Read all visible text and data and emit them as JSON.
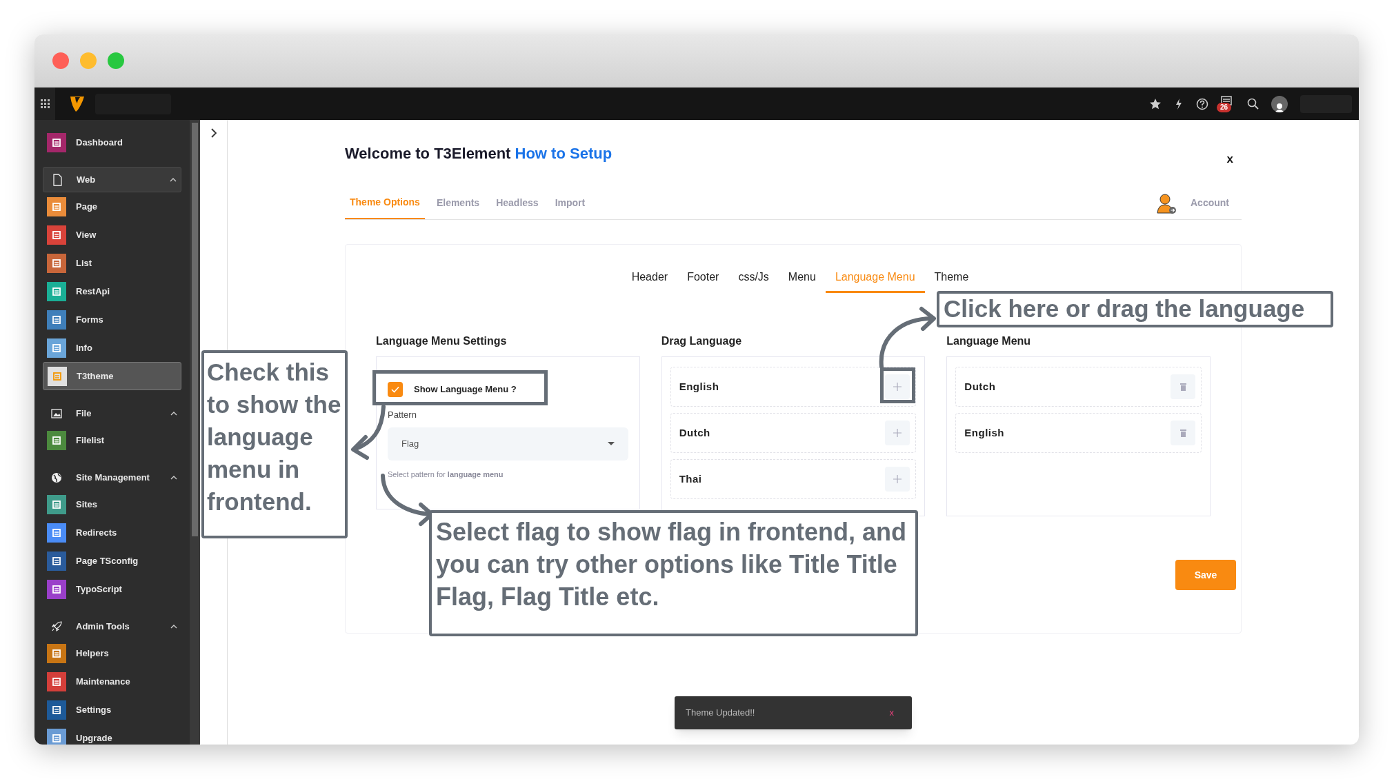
{
  "topbar": {
    "notification_count": "26"
  },
  "sidebar": [
    {
      "kind": "module",
      "label": "Dashboard",
      "color": "#a4276a",
      "selected": false
    },
    {
      "kind": "group",
      "label": "Web",
      "expanded": true,
      "selected": true,
      "children": [
        {
          "kind": "module",
          "label": "Page",
          "color": "#ea8c3a",
          "selected": false
        },
        {
          "kind": "module",
          "label": "View",
          "color": "#d9433a",
          "selected": false
        },
        {
          "kind": "module",
          "label": "List",
          "color": "#c8663a",
          "selected": false
        },
        {
          "kind": "module",
          "label": "RestApi",
          "color": "#1aaf96",
          "selected": false
        },
        {
          "kind": "module",
          "label": "Forms",
          "color": "#3f7fba",
          "selected": false
        },
        {
          "kind": "module",
          "label": "Info",
          "color": "#6aa5d9",
          "selected": false
        },
        {
          "kind": "module",
          "label": "T3theme",
          "color": "#e0e0e0",
          "selected": true
        }
      ]
    },
    {
      "kind": "group",
      "label": "File",
      "expanded": true,
      "selected": false,
      "children": [
        {
          "kind": "module",
          "label": "Filelist",
          "color": "#4c8a3e",
          "selected": false
        }
      ]
    },
    {
      "kind": "group",
      "label": "Site Management",
      "expanded": true,
      "selected": false,
      "children": [
        {
          "kind": "module",
          "label": "Sites",
          "color": "#3f9b8a",
          "selected": false
        },
        {
          "kind": "module",
          "label": "Redirects",
          "color": "#4a8cf6",
          "selected": false
        },
        {
          "kind": "module",
          "label": "Page TSconfig",
          "color": "#2a5b9b",
          "selected": false
        },
        {
          "kind": "module",
          "label": "TypoScript",
          "color": "#9a3fc9",
          "selected": false
        }
      ]
    },
    {
      "kind": "group",
      "label": "Admin Tools",
      "expanded": true,
      "selected": false,
      "children": [
        {
          "kind": "module",
          "label": "Helpers",
          "color": "#c87514",
          "selected": false
        },
        {
          "kind": "module",
          "label": "Maintenance",
          "color": "#d43f3a",
          "selected": false
        },
        {
          "kind": "module",
          "label": "Settings",
          "color": "#1d5a99",
          "selected": false
        },
        {
          "kind": "module",
          "label": "Upgrade",
          "color": "#6a9bd4",
          "selected": false
        }
      ]
    }
  ],
  "main": {
    "title": "Welcome to T3Element",
    "title_link": "How to Setup",
    "close": "x",
    "tabs": [
      {
        "label": "Theme Options",
        "selected": true
      },
      {
        "label": "Elements",
        "selected": false
      },
      {
        "label": "Headless",
        "selected": false
      },
      {
        "label": "Import",
        "selected": false
      }
    ],
    "account": "Account",
    "subtabs": [
      {
        "label": "Header",
        "selected": false
      },
      {
        "label": "Footer",
        "selected": false
      },
      {
        "label": "css/Js",
        "selected": false
      },
      {
        "label": "Menu",
        "selected": false
      },
      {
        "label": "Language Menu",
        "selected": true
      },
      {
        "label": "Theme",
        "selected": false
      }
    ],
    "settings": {
      "heading": "Language Menu Settings",
      "show_menu": {
        "label": "Show Language Menu ?",
        "checked": true
      },
      "pattern_label": "Pattern",
      "pattern_value": "Flag",
      "help": "Select pattern for **language menu**"
    },
    "drag_language": {
      "heading": "Drag Language",
      "items": [
        "English",
        "Dutch",
        "Thai"
      ]
    },
    "language_menu": {
      "heading": "Language Menu",
      "items": [
        "Dutch",
        "English"
      ]
    },
    "save": "Save"
  },
  "toast": {
    "text": "Theme Updated!!",
    "close": "x"
  },
  "annotations": [
    "Check this to show the language menu in frontend.",
    "Select flag to show flag in frontend, and you can try other options like Title Title Flag, Flag Title etc.",
    "Click here or drag the language"
  ]
}
